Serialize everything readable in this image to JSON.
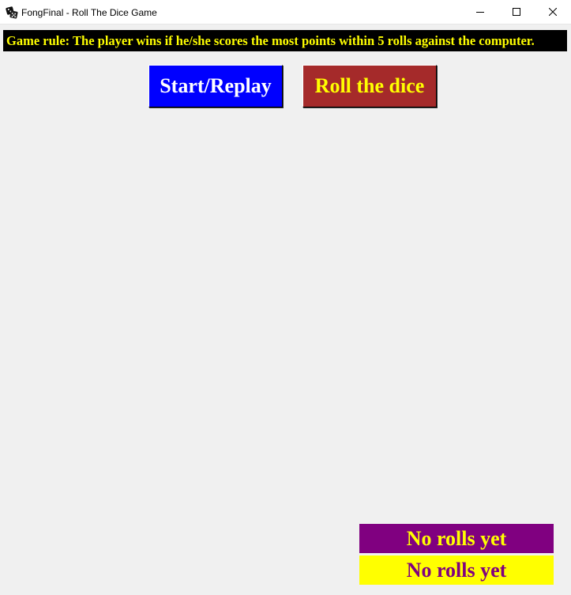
{
  "window": {
    "title": "FongFinal - Roll The Dice Game",
    "app_icon": "dice-icon"
  },
  "rule": {
    "text": "Game rule: The player wins if he/she scores the most points within 5 rolls against the computer.",
    "background": "#000000",
    "color": "#ffff00"
  },
  "buttons": {
    "start_label": "Start/Replay",
    "start_bg": "#0000ff",
    "start_color": "#ffffff",
    "roll_label": "Roll the dice",
    "roll_bg": "#a52a2a",
    "roll_color": "#ffff00"
  },
  "results": {
    "player_text": "No rolls yet",
    "player_bg": "#800080",
    "player_color": "#ffff00",
    "computer_text": "No rolls yet",
    "computer_bg": "#ffff00",
    "computer_color": "#800080"
  }
}
